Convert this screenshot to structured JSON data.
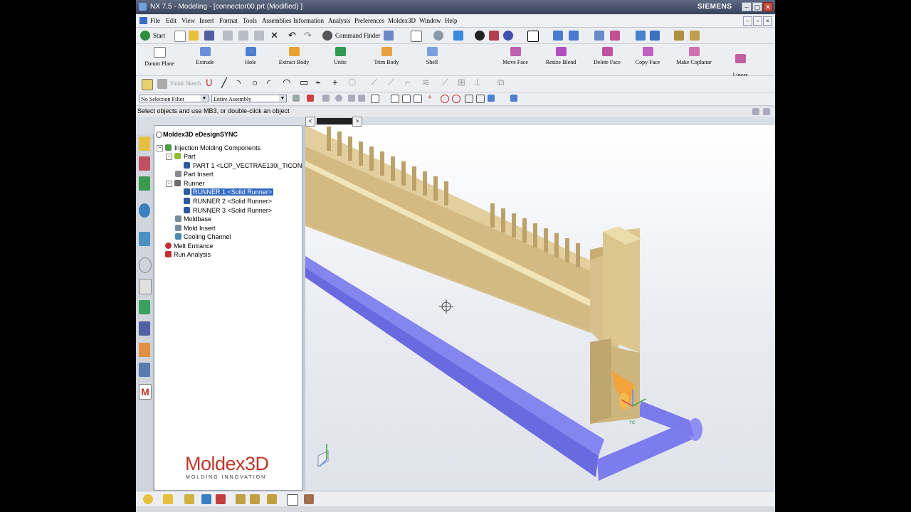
{
  "window": {
    "title": "NX 7.5 - Modeling - [connector00.prt (Modified) ]",
    "brand": "SIEMENS",
    "controls": [
      "–",
      "▢",
      "✕"
    ]
  },
  "menu": {
    "items": [
      "File",
      "Edit",
      "View",
      "Insert",
      "Format",
      "Tools",
      "Assemblies",
      "Information",
      "Analysis",
      "Preferences",
      "Moldex3D",
      "Window",
      "Help"
    ]
  },
  "standard_toolbar": {
    "start_label": "Start",
    "command_finder_label": "Command Finder"
  },
  "feature_toolbar": {
    "buttons": [
      {
        "label": "Datum Plane",
        "icon": "datum-plane-icon",
        "color": "#e8e8e8"
      },
      {
        "label": "Extrude",
        "icon": "extrude-icon",
        "color": "#6a8fd8"
      },
      {
        "label": "Hole",
        "icon": "hole-icon",
        "color": "#4f7fd0"
      },
      {
        "label": "Extract Body",
        "icon": "extract-body-icon",
        "color": "#e8a030"
      },
      {
        "label": "Unite",
        "icon": "unite-icon",
        "color": "#2f9a50"
      },
      {
        "label": "Trim Body",
        "icon": "trim-body-icon",
        "color": "#e8a040"
      },
      {
        "label": "Shell",
        "icon": "shell-icon",
        "color": "#7aa0e0"
      },
      {
        "label": "Move Face",
        "icon": "move-face-icon",
        "color": "#c060b0"
      },
      {
        "label": "Resize Blend",
        "icon": "resize-blend-icon",
        "color": "#b050c0"
      },
      {
        "label": "Delete Face",
        "icon": "delete-face-icon",
        "color": "#c050a0"
      },
      {
        "label": "Copy Face",
        "icon": "copy-face-icon",
        "color": "#c060c0"
      },
      {
        "label": "Make Coplanar",
        "icon": "make-coplanar-icon",
        "color": "#d070b0"
      },
      {
        "label": "Linear\nDimension",
        "icon": "linear-dimension-icon",
        "color": "#c060a0"
      }
    ]
  },
  "sketch_toolbar": {
    "finish_sketch_label": "Finish Sketch"
  },
  "selection_bar": {
    "filter_value": "No Selection Filter",
    "scope_value": "Entire Assembly"
  },
  "cue_line": {
    "text": "Select objects and use MB3, or double-click an object"
  },
  "navigator": {
    "header": "Moldex3D eDesignSYNC",
    "tree": [
      {
        "label": "Injection Molding Components",
        "level": 0,
        "expander": "⊟",
        "color": "#4a9a4a"
      },
      {
        "label": "Part",
        "level": 1,
        "expander": "⊟",
        "color": "#8fbf3a"
      },
      {
        "label": "PART 1 <LCP_VECTRAE130i_TICON",
        "level": 2,
        "expander": "",
        "color": "#2a5aa0"
      },
      {
        "label": "Part Insert",
        "level": 1,
        "expander": "",
        "color": "#8a8a8a"
      },
      {
        "label": "Runner",
        "level": 1,
        "expander": "⊟",
        "color": "#6a6a6a"
      },
      {
        "label": "RUNNER 1 <Solid Runner>",
        "level": 2,
        "expander": "",
        "color": "#2a5aa0",
        "selected": true
      },
      {
        "label": "RUNNER 2 <Solid Runner>",
        "level": 2,
        "expander": "",
        "color": "#2a5aa0"
      },
      {
        "label": "RUNNER 3 <Solid Runner>",
        "level": 2,
        "expander": "",
        "color": "#2a5aa0"
      },
      {
        "label": "Moldbase",
        "level": 1,
        "expander": "",
        "color": "#7a8a9a"
      },
      {
        "label": "Mold Insert",
        "level": 1,
        "expander": "",
        "color": "#7a8a9a"
      },
      {
        "label": "Cooling Channel",
        "level": 1,
        "expander": "",
        "color": "#4a8ab0"
      },
      {
        "label": "Melt Entrance",
        "level": 0,
        "expander": "",
        "color": "#c03030"
      },
      {
        "label": "Run Analysis",
        "level": 0,
        "expander": "",
        "color": "#c03030"
      }
    ],
    "logo_text": "Moldex3D",
    "logo_tagline": "MOLDING INNOVATION"
  },
  "graphics": {
    "part_color": "#d8c08a",
    "runner_color": "#7c7cee",
    "gate_color": "#f2a23a",
    "triad_label": "YC"
  },
  "scroll": {
    "left": "<",
    "right": ">"
  }
}
